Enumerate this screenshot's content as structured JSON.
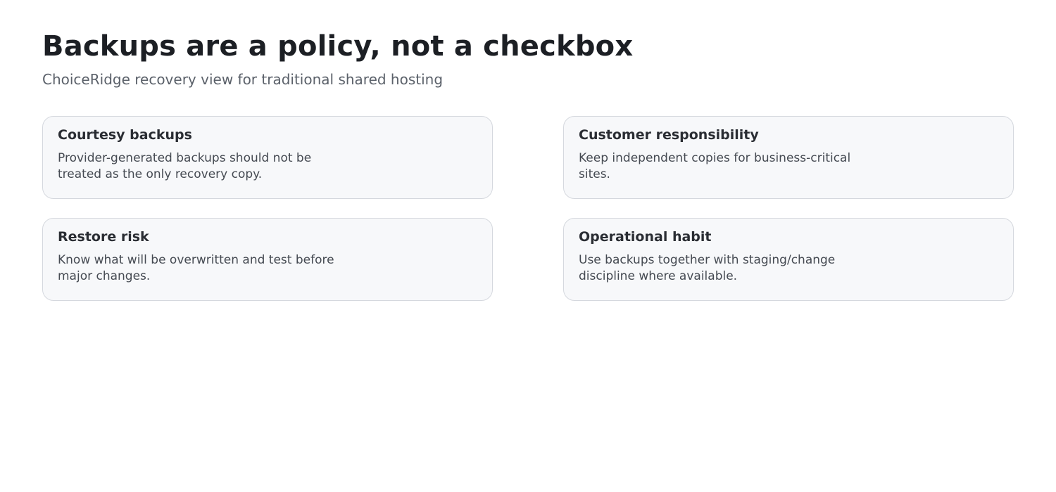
{
  "header": {
    "title": "Backups are a policy, not a checkbox",
    "subtitle": "ChoiceRidge recovery view for traditional shared hosting"
  },
  "cards": [
    {
      "title": "Courtesy backups",
      "body": "Provider-generated backups should not be treated as the only recovery copy."
    },
    {
      "title": "Customer responsibility",
      "body": "Keep independent copies for business-critical sites."
    },
    {
      "title": "Restore risk",
      "body": "Know what will be overwritten and test before major changes."
    },
    {
      "title": "Operational habit",
      "body": "Use backups together with staging/change discipline where available."
    }
  ]
}
